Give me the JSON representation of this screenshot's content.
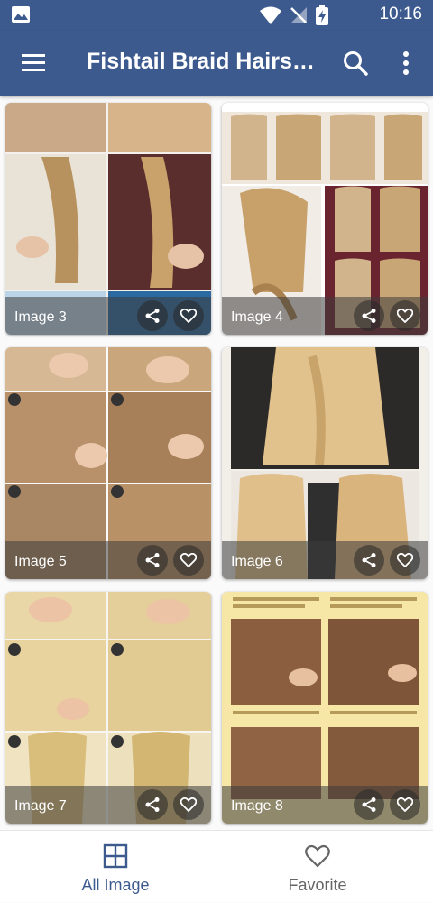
{
  "status_bar": {
    "time": "10:16",
    "icons": [
      "image-notification-icon",
      "wifi-icon",
      "signal-off-icon",
      "battery-charging-icon"
    ]
  },
  "app_bar": {
    "title": "Fishtail Braid Hairstyles",
    "menu_icon": "hamburger-menu-icon",
    "search_icon": "search-icon",
    "more_icon": "more-vert-icon"
  },
  "cards": [
    {
      "caption": "Image 3"
    },
    {
      "caption": "Image 4"
    },
    {
      "caption": "Image 5"
    },
    {
      "caption": "Image 6"
    },
    {
      "caption": "Image 7"
    },
    {
      "caption": "Image 8"
    }
  ],
  "bottom_nav": {
    "all_image": "All Image",
    "favorite": "Favorite"
  },
  "colors": {
    "primary": "#3d5a8f",
    "nav_active": "#3d5a8f",
    "nav_inactive": "#666666"
  }
}
